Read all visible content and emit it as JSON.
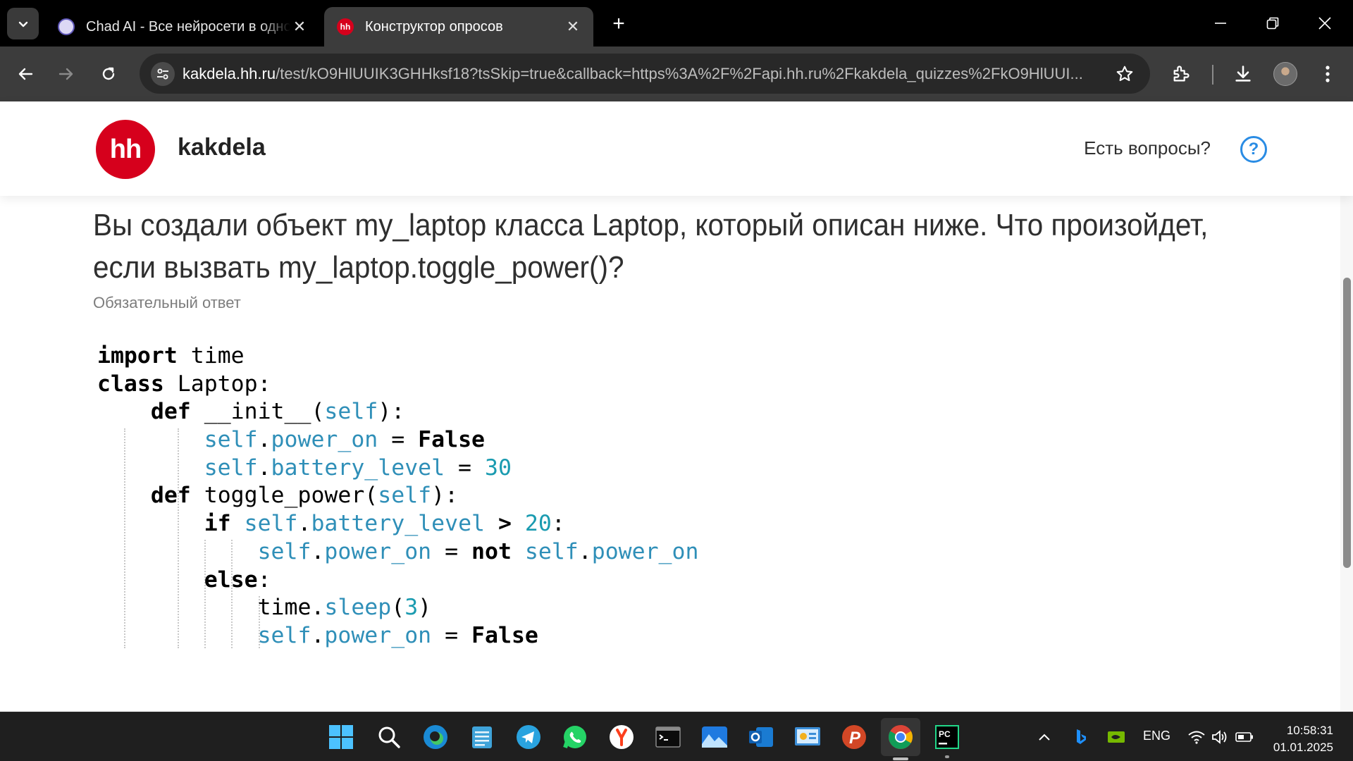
{
  "browser": {
    "tabs": [
      {
        "title": "Chad AI - Все нейросети в одном",
        "favicon": "chad-ai-icon",
        "active": false
      },
      {
        "title": "Конструктор опросов",
        "favicon": "hh",
        "active": true
      }
    ],
    "url_host": "kakdela.hh.ru",
    "url_path": "/test/kO9HlUUIK3GHHksf18?tsSkip=true&callback=https%3A%2F%2Fapi.hh.ru%2Fkakdela_quizzes%2FkO9HlUUI...",
    "new_tab_label": "+"
  },
  "page": {
    "logo_text": "hh",
    "brand": "kakdela",
    "help_text": "Есть вопросы?",
    "help_icon_glyph": "?",
    "question": "Вы создали объект my_laptop класса Laptop, который описан ниже. Что произойдет, если вызвать my_laptop.toggle_power()?",
    "required_note": "Обязательный ответ",
    "code_lines": [
      "import time",
      "class Laptop:",
      "    def __init__(self):",
      "        self.power_on = False",
      "        self.battery_level = 30",
      "    def toggle_power(self):",
      "        if self.battery_level > 20:",
      "            self.power_on = not self.power_on",
      "        else:",
      "            time.sleep(3)",
      "            self.power_on = False"
    ]
  },
  "taskbar": {
    "apps": [
      "windows-start",
      "search",
      "edge",
      "notepad",
      "telegram",
      "whatsapp",
      "yandex",
      "terminal",
      "photos",
      "outlook",
      "control-panel",
      "powerpoint",
      "chrome",
      "pycharm"
    ],
    "language": "ENG",
    "time": "10:58:31",
    "date": "01.01.2025",
    "pycharm_label": "PC",
    "powerpoint_label": "P"
  },
  "colors": {
    "hh_red": "#d6001c",
    "help_blue": "#2a8ce4",
    "code_self": "#2f8fb8",
    "code_number": "#1a9bb0"
  }
}
